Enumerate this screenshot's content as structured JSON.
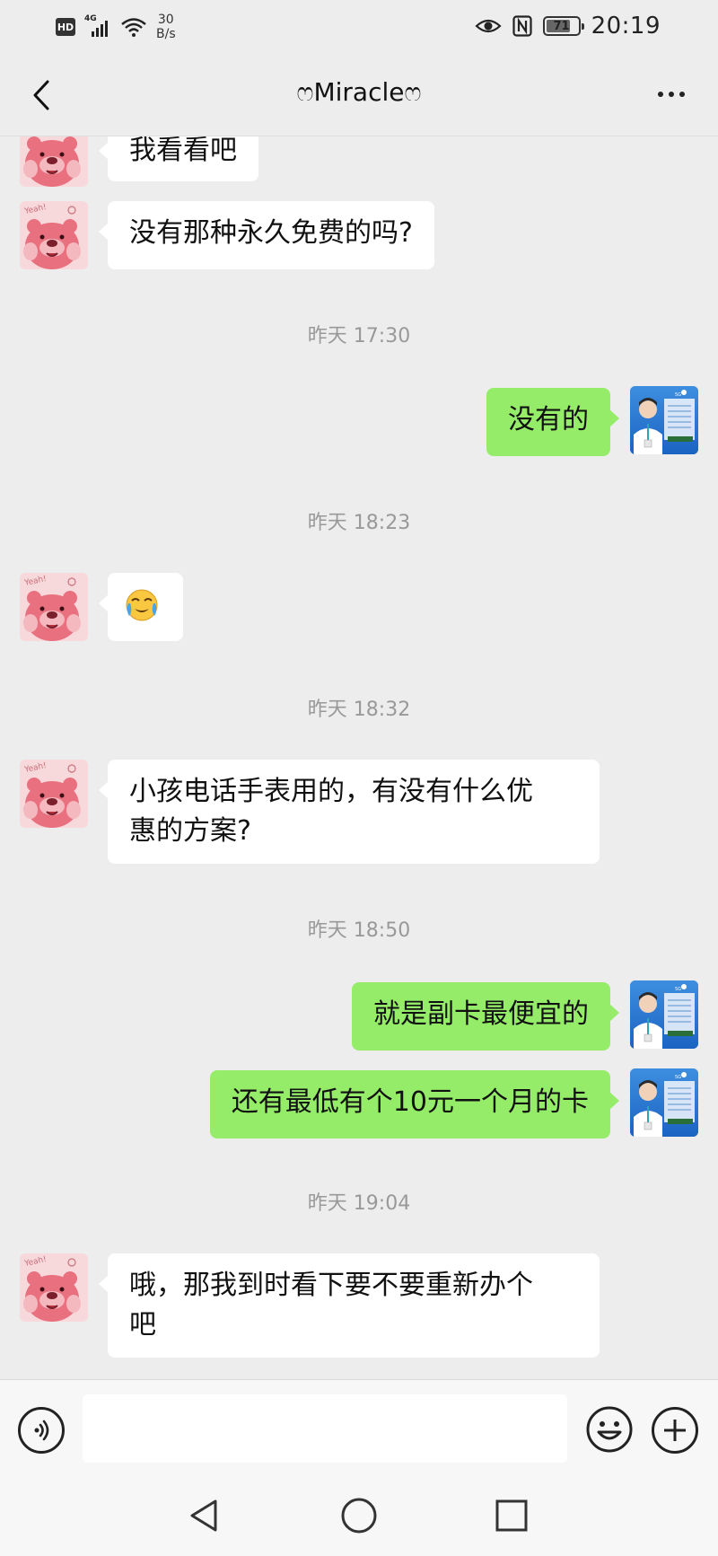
{
  "status_bar": {
    "hd": "HD",
    "network": "4G",
    "speed_value": "30",
    "speed_unit": "B/s",
    "battery": "71",
    "time": "20:19"
  },
  "header": {
    "title": "ෆMiracleෆ"
  },
  "messages": [
    {
      "side": "in",
      "text": "我看看吧"
    },
    {
      "side": "in",
      "text": "没有那种永久免费的吗?"
    },
    {
      "type": "time",
      "text": "昨天 17:30"
    },
    {
      "side": "out",
      "text": "没有的"
    },
    {
      "type": "time",
      "text": "昨天 18:23"
    },
    {
      "side": "in",
      "text": "😭",
      "emoji": "crying-emoji"
    },
    {
      "type": "time",
      "text": "昨天 18:32"
    },
    {
      "side": "in",
      "text_line1": "小孩电话手表用的，有没有什么优",
      "text_line2": "惠的方案?"
    },
    {
      "type": "time",
      "text": "昨天 18:50"
    },
    {
      "side": "out",
      "text": "就是副卡最便宜的"
    },
    {
      "side": "out",
      "text": "还有最低有个10元一个月的卡"
    },
    {
      "type": "time",
      "text": "昨天 19:04"
    },
    {
      "side": "in",
      "text_line1": "哦，那我到时看下要不要重新办个",
      "text_line2": "吧"
    }
  ],
  "input": {
    "placeholder": ""
  },
  "colors": {
    "background": "#ededed",
    "incoming_bubble": "#ffffff",
    "outgoing_bubble": "#95ec69",
    "timestamp": "#999999"
  },
  "icons": {
    "back": "chevron-left-icon",
    "more": "more-dots-icon",
    "voice": "voice-icon",
    "emoji": "emoji-icon",
    "plus": "plus-icon",
    "nav_back": "nav-back-icon",
    "nav_home": "nav-home-icon",
    "nav_recent": "nav-recent-icon"
  }
}
